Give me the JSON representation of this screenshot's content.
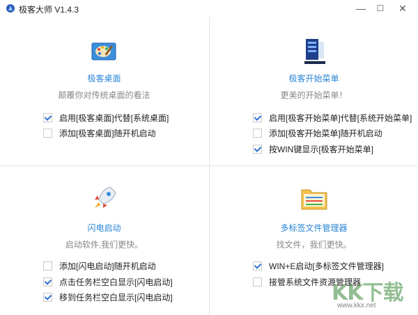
{
  "window": {
    "title": "极客大师 V1.4.3",
    "controls": {
      "minimize": "—",
      "maximize": "☐",
      "close": "✕"
    }
  },
  "panels": [
    {
      "title": "极客桌面",
      "desc": "颠覆你对传统桌面的看法",
      "icon": "desktop-palette-icon",
      "options": [
        {
          "label": "启用[极客桌面]代替[系统桌面]",
          "checked": true
        },
        {
          "label": "添加[极客桌面]随开机启动",
          "checked": false
        }
      ]
    },
    {
      "title": "极客开始菜单",
      "desc": "更美的开始菜单！",
      "icon": "start-menu-icon",
      "options": [
        {
          "label": "启用[极客开始菜单]代替[系统开始菜单]",
          "checked": true
        },
        {
          "label": "添加[极客开始菜单]随开机启动",
          "checked": false
        },
        {
          "label": "按WIN键显示[极客开始菜单]",
          "checked": true
        }
      ]
    },
    {
      "title": "闪电启动",
      "desc": "启动软件,我们更快。",
      "icon": "rocket-icon",
      "options": [
        {
          "label": "添加[闪电启动]随开机启动",
          "checked": false
        },
        {
          "label": "点击任务栏空白显示[闪电启动]",
          "checked": true
        },
        {
          "label": "移到任务栏空白显示[闪电启动]",
          "checked": true
        }
      ]
    },
    {
      "title": "多标签文件管理器",
      "desc": "找文件，我们更快。",
      "icon": "folder-icon",
      "options": [
        {
          "label": "WIN+E启动[多标签文件管理器]",
          "checked": true
        },
        {
          "label": "接管系统文件资源管理器",
          "checked": false
        }
      ]
    }
  ],
  "watermark": {
    "text": "KK下载",
    "url": "www.kkx.net"
  }
}
